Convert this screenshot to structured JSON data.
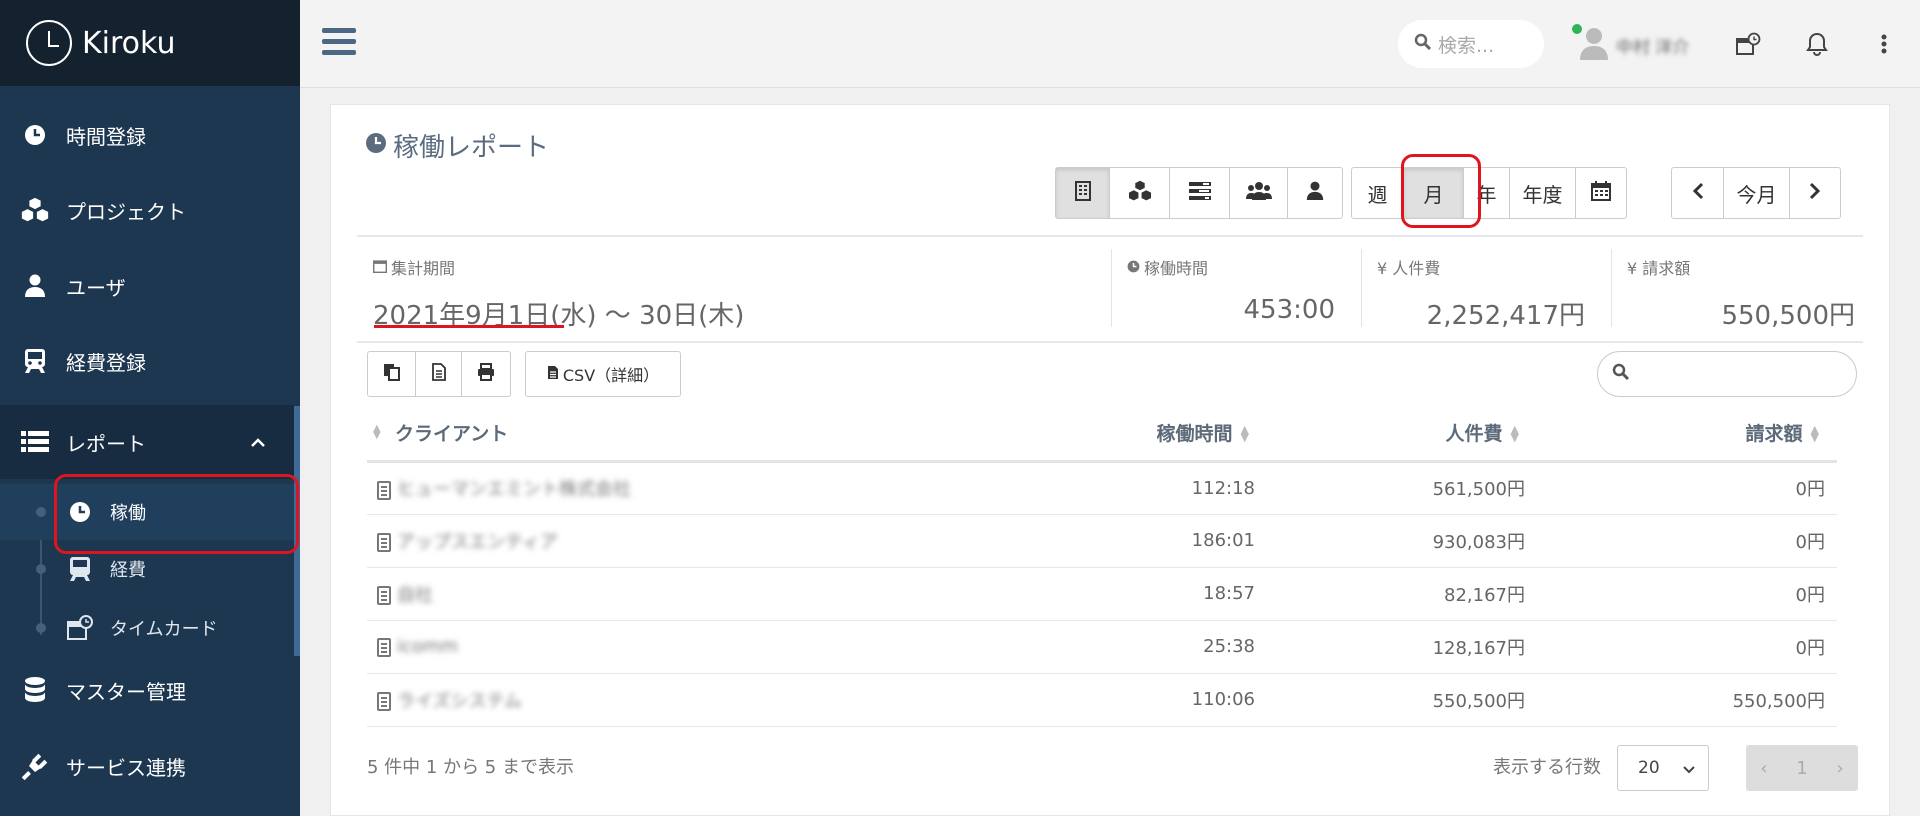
{
  "app": {
    "name": "Kiroku"
  },
  "sidebar": {
    "items": [
      {
        "label": "時間登録",
        "icon": "clock-icon"
      },
      {
        "label": "プロジェクト",
        "icon": "cubes-icon"
      },
      {
        "label": "ユーザ",
        "icon": "user-icon"
      },
      {
        "label": "経費登録",
        "icon": "train-icon"
      },
      {
        "label": "レポート",
        "icon": "list-icon",
        "expanded": true
      },
      {
        "label": "マスター管理",
        "icon": "database-icon"
      },
      {
        "label": "サービス連携",
        "icon": "plug-icon"
      }
    ],
    "report_sub": [
      {
        "label": "稼働",
        "icon": "clock-icon",
        "active": true
      },
      {
        "label": "経費",
        "icon": "train-icon"
      },
      {
        "label": "タイムカード",
        "icon": "timecard-icon"
      }
    ]
  },
  "topbar": {
    "search_placeholder": "検索...",
    "user_name": "中村 洋介"
  },
  "report": {
    "title": "稼働レポート",
    "view_buttons": [
      "building-icon",
      "cubes-icon",
      "tasks-icon",
      "users-icon",
      "user-icon"
    ],
    "period_buttons": [
      "週",
      "月",
      "年",
      "年度"
    ],
    "selected_period": "月",
    "today_label": "今月",
    "stats": {
      "period_label": "集計期間",
      "period_value": "2021年9月1日(水) 〜 30日(木)",
      "hours_label": "稼働時間",
      "hours_value": "453:00",
      "cost_label": "¥ 人件費",
      "cost_value": "2,252,417円",
      "billing_label": "¥ 請求額",
      "billing_value": "550,500円"
    },
    "tools": {
      "csv_label": "CSV（詳細）"
    },
    "table": {
      "headers": [
        "クライアント",
        "稼働時間",
        "人件費",
        "請求額"
      ],
      "rows": [
        {
          "client": "ヒューマンエミント株式会社",
          "hours": "112:18",
          "cost": "561,500円",
          "billing": "0円"
        },
        {
          "client": "アップスエンティア",
          "hours": "186:01",
          "cost": "930,083円",
          "billing": "0円"
        },
        {
          "client": "自社",
          "hours": "18:57",
          "cost": "82,167円",
          "billing": "0円"
        },
        {
          "client": "icomm",
          "hours": "25:38",
          "cost": "128,167円",
          "billing": "0円"
        },
        {
          "client": "ライズシステム",
          "hours": "110:06",
          "cost": "550,500円",
          "billing": "550,500円"
        }
      ]
    },
    "footer": {
      "summary": "5 件中 1 から 5 まで表示",
      "rows_label": "表示する行数",
      "rows_value": "20",
      "page": "1"
    }
  },
  "colors": {
    "sidebar": "#1d3750",
    "logo_bg": "#14212e",
    "highlight": "#e0141e",
    "status_online": "#2fb457"
  }
}
